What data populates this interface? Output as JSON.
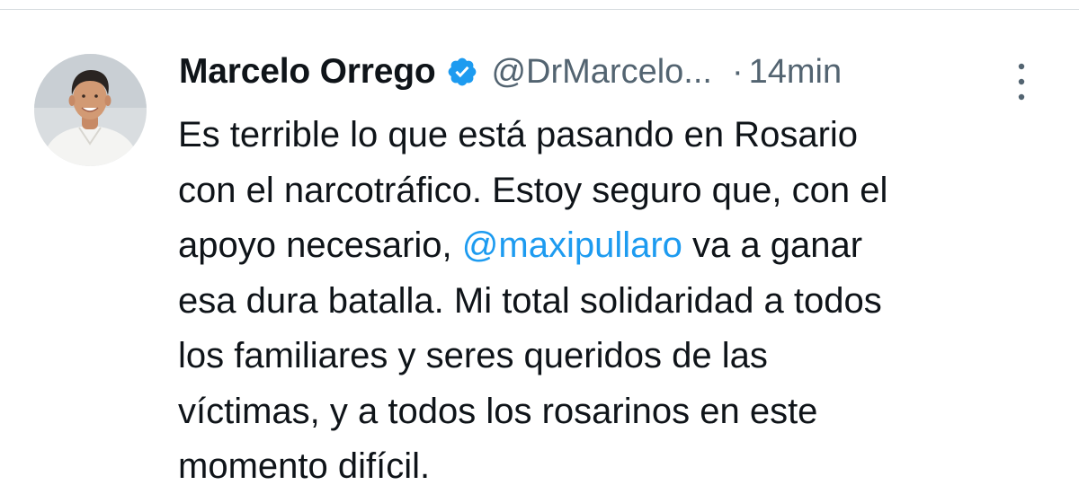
{
  "tweet": {
    "author_name": "Marcelo Orrego",
    "author_handle": "@DrMarcelo...",
    "separator": "·",
    "timestamp": "14min",
    "verified_icon": "verified-badge-icon",
    "more_icon": "more-options-icon",
    "avatar_icon": "profile-avatar",
    "accent_color": "#1d9bf0",
    "text_lines": [
      {
        "text": "Es terrible lo que está pasando en Rosario"
      },
      {
        "text": "con el narcotráfico. Estoy seguro que, con el"
      },
      {
        "before": "apoyo necesario, ",
        "mention": "@maxipullaro",
        "after": " va a ganar"
      },
      {
        "text": "esa dura batalla. Mi total solidaridad a todos"
      },
      {
        "text": "los familiares y seres queridos de las"
      },
      {
        "text": "víctimas, y a todos los rosarinos en este"
      },
      {
        "text": "momento difícil."
      }
    ]
  }
}
